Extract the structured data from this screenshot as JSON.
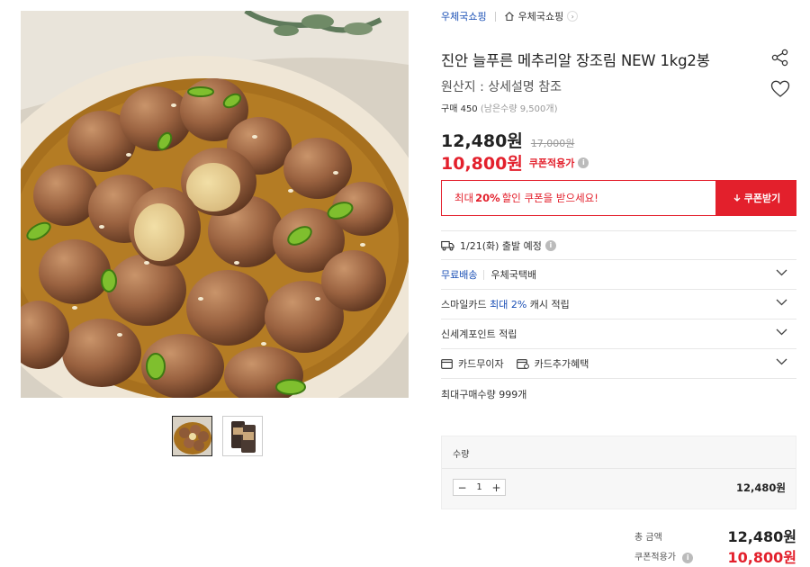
{
  "breadcrumb": {
    "store": "우체국쇼핑",
    "home_label": "우체국쇼핑"
  },
  "product": {
    "title": "진안 늘푸른 메추리알 장조림 NEW 1kg2봉",
    "origin": "원산지 : 상세설명 참조",
    "purchase_count": "구매 450",
    "remaining": "(남은수량 9,500개)"
  },
  "price": {
    "sale": "12,480원",
    "original": "17,000원",
    "coupon_price": "10,800원",
    "coupon_label": "쿠폰적용가"
  },
  "coupon_banner": {
    "prefix": "최대",
    "percent": "20%",
    "suffix": "할인 쿠폰을 받으세요!",
    "button": "쿠폰받기"
  },
  "shipping": {
    "date_text": "1/21(화) 출발 예정"
  },
  "options": [
    {
      "label": "무료배송",
      "extra": "우체국택배"
    },
    {
      "label_pre": "스마일카드",
      "label_highlight": "최대 2%",
      "label_post": "캐시 적립"
    },
    {
      "label": "신세계포인트 적립"
    },
    {
      "label_a": "카드무이자",
      "label_b": "카드추가혜택"
    }
  ],
  "max_purchase": "최대구매수량 999개",
  "quantity": {
    "label": "수량",
    "value": "1",
    "line_price": "12,480원"
  },
  "totals": {
    "total_label": "총 금액",
    "total_value": "12,480원",
    "coupon_label": "쿠폰적용가",
    "coupon_value": "10,800원"
  },
  "icons": [
    "home-icon",
    "chevron-right-icon",
    "share-icon",
    "heart-icon",
    "truck-icon",
    "info-icon",
    "chevron-down-icon",
    "card-icon",
    "download-icon"
  ],
  "colors": {
    "accent_red": "#e3202c",
    "link_blue": "#1a4fb5"
  }
}
